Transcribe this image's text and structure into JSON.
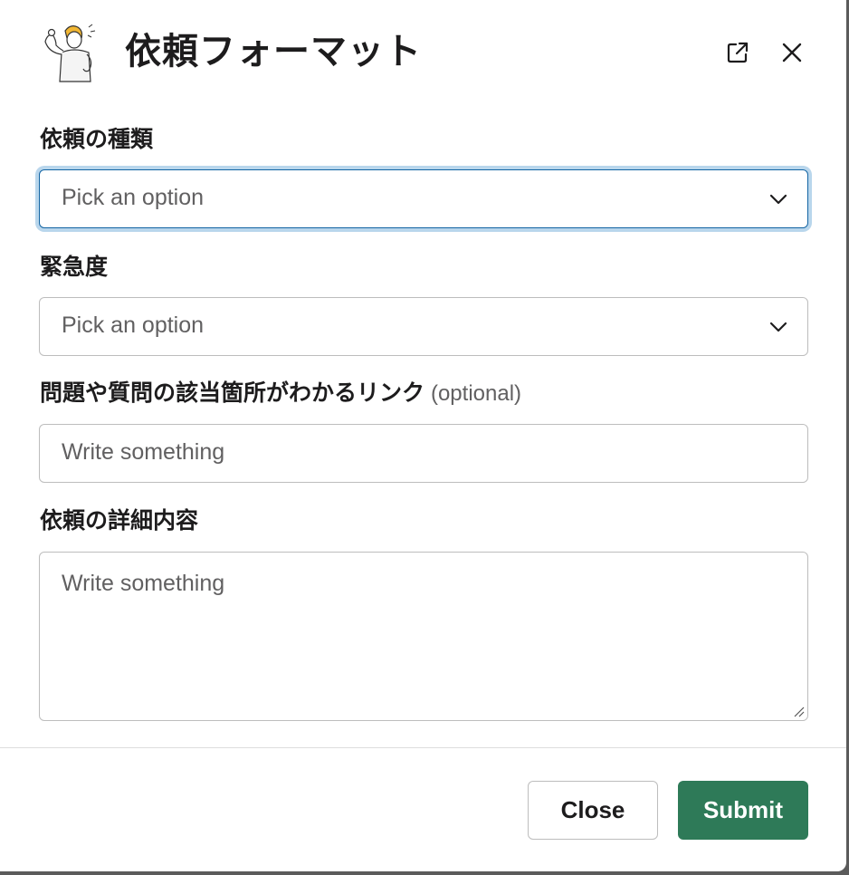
{
  "modal": {
    "title": "依頼フォーマット",
    "icons": {
      "avatar": "flexing-person-illustration",
      "popout": "external-link-icon",
      "close": "close-icon"
    }
  },
  "form": {
    "request_type": {
      "label": "依頼の種類",
      "placeholder": "Pick an option"
    },
    "urgency": {
      "label": "緊急度",
      "placeholder": "Pick an option"
    },
    "link": {
      "label": "問題や質問の該当箇所がわかるリンク",
      "optional": "(optional)",
      "placeholder": "Write something"
    },
    "details": {
      "label": "依頼の詳細内容",
      "placeholder": "Write something"
    }
  },
  "footer": {
    "close_label": "Close",
    "submit_label": "Submit"
  },
  "colors": {
    "submit_bg": "#2e7a58",
    "focus_ring": "#b9d6ec",
    "focus_border": "#1264a3"
  }
}
